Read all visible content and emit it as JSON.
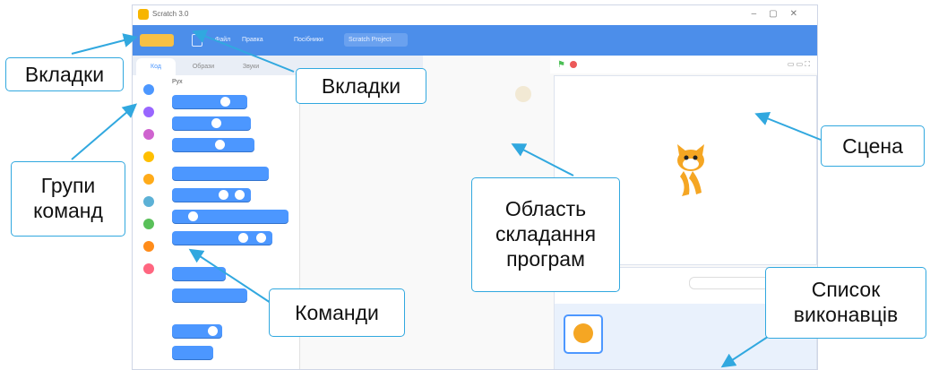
{
  "window": {
    "title": "Scratch 3.0"
  },
  "menubar": {
    "items": [
      "Файл",
      "Правка",
      "Посібники"
    ],
    "project_title": "Scratch Project"
  },
  "palette": {
    "tabs": [
      "Код",
      "Образи",
      "Звуки"
    ],
    "section_title": "Рух",
    "categories": [
      {
        "color": "#4c97ff"
      },
      {
        "color": "#9966ff"
      },
      {
        "color": "#cf63cf"
      },
      {
        "color": "#ffbf00"
      },
      {
        "color": "#ffab19"
      },
      {
        "color": "#5cb1d6"
      },
      {
        "color": "#59c059"
      },
      {
        "color": "#ff8c1a"
      },
      {
        "color": "#ff6680"
      }
    ]
  },
  "colors": {
    "accent": "#4c8eea",
    "callout_border": "#31a8df",
    "arrow": "#31a8df"
  },
  "callouts": {
    "tabs_left": "Вкладки",
    "tabs_top": "Вкладки",
    "groups_line1": "Групи",
    "groups_line2": "команд",
    "commands": "Команди",
    "workspace_line1": "Область",
    "workspace_line2": "складання",
    "workspace_line3": "програм",
    "stage": "Сцена",
    "sprites_line1": "Список",
    "sprites_line2": "виконавців"
  },
  "icons": [
    "scratch-logo-icon",
    "language-icon",
    "green-flag-icon",
    "stop-icon",
    "cat-sprite-icon"
  ]
}
